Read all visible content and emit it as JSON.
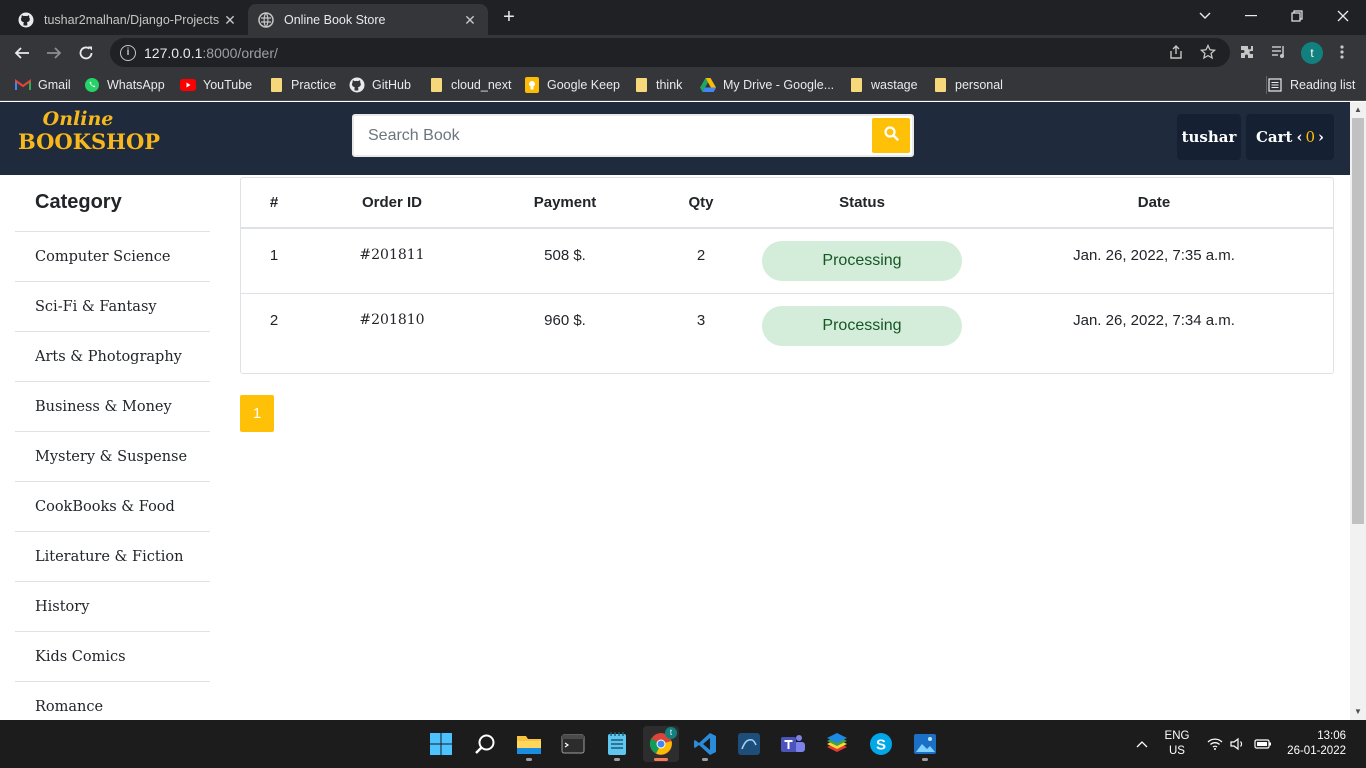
{
  "browser": {
    "tabs": [
      {
        "title": "tushar2malhan/Django-Projects",
        "icon": "github-icon",
        "active": false
      },
      {
        "title": "Online Book Store",
        "icon": "globe-icon",
        "active": true
      }
    ],
    "url_host": "127.0.0.1",
    "url_path": ":8000/order/",
    "profile_initial": "t",
    "bookmarks": [
      {
        "label": "Gmail",
        "icon": "gmail-icon"
      },
      {
        "label": "WhatsApp",
        "icon": "whatsapp-icon"
      },
      {
        "label": "YouTube",
        "icon": "youtube-icon"
      },
      {
        "label": "Practice",
        "icon": "folder-icon"
      },
      {
        "label": "GitHub",
        "icon": "github-icon"
      },
      {
        "label": "cloud_next",
        "icon": "folder-icon"
      },
      {
        "label": "Google Keep",
        "icon": "keep-icon"
      },
      {
        "label": "think",
        "icon": "folder-icon"
      },
      {
        "label": "My Drive - Google...",
        "icon": "drive-icon"
      },
      {
        "label": "wastage",
        "icon": "folder-icon"
      },
      {
        "label": "personal",
        "icon": "folder-icon"
      }
    ],
    "reading_list": "Reading list"
  },
  "site": {
    "logo_line1": "Online",
    "logo_line2": "BOOKSHOP",
    "search_placeholder": "Search Book",
    "user_label": "tushar",
    "cart_label": "Cart",
    "cart_count": "0",
    "accent_color": "#ffc107",
    "header_color": "#1f2a3d"
  },
  "sidebar": {
    "title": "Category",
    "items": [
      "Computer Science",
      "Sci-Fi & Fantasy",
      "Arts & Photography",
      "Business & Money",
      "Mystery & Suspense",
      "CookBooks & Food",
      "Literature & Fiction",
      "History",
      "Kids Comics",
      "Romance"
    ]
  },
  "orders": {
    "columns": [
      "#",
      "Order ID",
      "Payment",
      "Qty",
      "Status",
      "Date"
    ],
    "rows": [
      {
        "num": "1",
        "order_id": "#201811",
        "payment": "508 $.",
        "qty": "2",
        "status": "Processing",
        "date": "Jan. 26, 2022, 7:35 a.m."
      },
      {
        "num": "2",
        "order_id": "#201810",
        "payment": "960 $.",
        "qty": "3",
        "status": "Processing",
        "date": "Jan. 26, 2022, 7:34 a.m."
      }
    ],
    "page": "1"
  },
  "taskbar": {
    "lang_line1": "ENG",
    "lang_line2": "US",
    "time": "13:06",
    "date": "26-01-2022",
    "apps": [
      "windows-start-icon",
      "search-icon",
      "file-explorer-icon",
      "terminal-icon",
      "notepad-icon",
      "chrome-icon",
      "vscode-icon",
      "mysql-workbench-icon",
      "teams-icon",
      "bluestacks-icon",
      "skype-icon",
      "photos-icon"
    ]
  }
}
